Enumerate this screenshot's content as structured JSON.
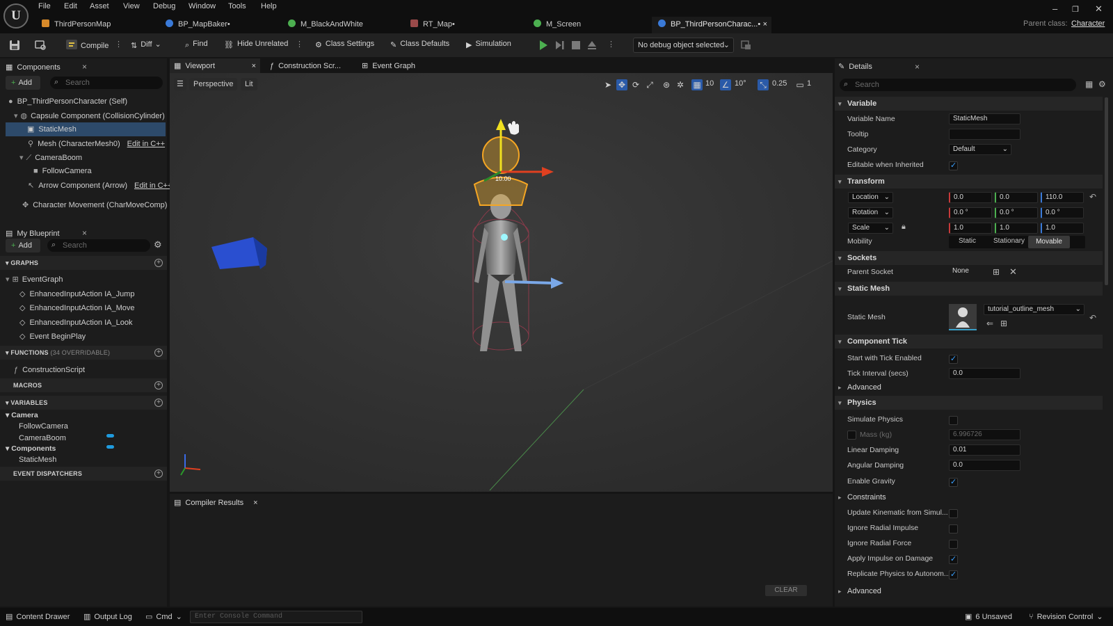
{
  "menu": [
    "File",
    "Edit",
    "Asset",
    "View",
    "Debug",
    "Window",
    "Tools",
    "Help"
  ],
  "tabs": [
    {
      "label": "ThirdPersonMap",
      "color": "#d88a2a"
    },
    {
      "label": "BP_MapBaker•",
      "color": "#3a7ad8"
    },
    {
      "label": "M_BlackAndWhite",
      "color": "#4caf50"
    },
    {
      "label": "RT_Map•",
      "color": "#9a4a4a"
    },
    {
      "label": "M_Screen",
      "color": "#4caf50"
    },
    {
      "label": "BP_ThirdPersonCharac...•",
      "color": "#3a7ad8"
    }
  ],
  "parent_class": {
    "label": "Parent class:",
    "value": "Character"
  },
  "toolbar": {
    "compile": "Compile",
    "diff": "Diff",
    "find": "Find",
    "hide_unrelated": "Hide Unrelated",
    "class_settings": "Class Settings",
    "class_defaults": "Class Defaults",
    "simulation": "Simulation",
    "debug_object": "No debug object selected"
  },
  "components": {
    "title": "Components",
    "add": "Add",
    "search_placeholder": "Search",
    "items": [
      {
        "label": "BP_ThirdPersonCharacter (Self)"
      },
      {
        "label": "Capsule Component (CollisionCylinder)"
      },
      {
        "label": "StaticMesh"
      },
      {
        "label": "Mesh (CharacterMesh0)",
        "extra": "Edit in C++"
      },
      {
        "label": "CameraBoom"
      },
      {
        "label": "FollowCamera"
      },
      {
        "label": "Arrow Component (Arrow)",
        "extra": "Edit in C++"
      },
      {
        "label": "Character Movement (CharMoveComp)"
      }
    ]
  },
  "my_blueprint": {
    "title": "My Blueprint",
    "add": "Add",
    "search_placeholder": "Search",
    "graphs_header": "GRAPHS",
    "event_graph": "EventGraph",
    "graph_items": [
      "EnhancedInputAction IA_Jump",
      "EnhancedInputAction IA_Move",
      "EnhancedInputAction IA_Look",
      "Event BeginPlay"
    ],
    "functions_header": "FUNCTIONS",
    "functions_note": "(34 OVERRIDABLE)",
    "construction_script": "ConstructionScript",
    "macros_header": "MACROS",
    "variables_header": "VARIABLES",
    "camera_group": "Camera",
    "camera_vars": [
      "FollowCamera",
      "CameraBoom"
    ],
    "components_group": "Components",
    "components_vars": [
      "StaticMesh"
    ],
    "event_dispatchers_header": "EVENT DISPATCHERS"
  },
  "editor_tabs": {
    "viewport": "Viewport",
    "construction": "Construction Scr...",
    "event_graph": "Event Graph"
  },
  "viewport": {
    "perspective": "Perspective",
    "lit": "Lit",
    "grid_snap": "10",
    "rot_snap": "10°",
    "scale_snap": "0.25",
    "cam_speed": "1",
    "gizmo_label": "10.00"
  },
  "compiler": {
    "title": "Compiler Results",
    "clear": "CLEAR"
  },
  "details": {
    "title": "Details",
    "search_placeholder": "Search",
    "variable_header": "Variable",
    "variable_name_label": "Variable Name",
    "variable_name": "StaticMesh",
    "tooltip_label": "Tooltip",
    "tooltip": "",
    "category_label": "Category",
    "category": "Default",
    "editable_label": "Editable when Inherited",
    "editable": true,
    "transform_header": "Transform",
    "location_label": "Location",
    "location": [
      "0.0",
      "0.0",
      "110.0"
    ],
    "rotation_label": "Rotation",
    "rotation": [
      "0.0 °",
      "0.0 °",
      "0.0 °"
    ],
    "scale_label": "Scale",
    "scale": [
      "1.0",
      "1.0",
      "1.0"
    ],
    "mobility_label": "Mobility",
    "mobility_options": [
      "Static",
      "Stationary",
      "Movable"
    ],
    "mobility_selected": "Movable",
    "sockets_header": "Sockets",
    "parent_socket_label": "Parent Socket",
    "parent_socket": "None",
    "static_mesh_header": "Static Mesh",
    "static_mesh_label": "Static Mesh",
    "static_mesh": "tutorial_outline_mesh",
    "tick_header": "Component Tick",
    "start_tick_label": "Start with Tick Enabled",
    "start_tick": true,
    "tick_interval_label": "Tick Interval (secs)",
    "tick_interval": "0.0",
    "advanced": "Advanced",
    "physics_header": "Physics",
    "simulate_label": "Simulate Physics",
    "simulate": false,
    "mass_label": "Mass (kg)",
    "mass": "6.996726",
    "linear_damping_label": "Linear Damping",
    "linear_damping": "0.01",
    "angular_damping_label": "Angular Damping",
    "angular_damping": "0.0",
    "gravity_label": "Enable Gravity",
    "gravity": true,
    "constraints": "Constraints",
    "update_kinematic_label": "Update Kinematic from Simul...",
    "update_kinematic": false,
    "ignore_radial_impulse_label": "Ignore Radial Impulse",
    "ignore_radial_impulse": false,
    "ignore_radial_force_label": "Ignore Radial Force",
    "ignore_radial_force": false,
    "apply_impulse_label": "Apply Impulse on Damage",
    "apply_impulse": true,
    "replicate_label": "Replicate Physics to Autonom...",
    "replicate": true,
    "advanced2": "Advanced"
  },
  "statusbar": {
    "content_drawer": "Content Drawer",
    "output_log": "Output Log",
    "cmd": "Cmd",
    "console_placeholder": "Enter Console Command",
    "unsaved": "6 Unsaved",
    "revision": "Revision Control"
  }
}
